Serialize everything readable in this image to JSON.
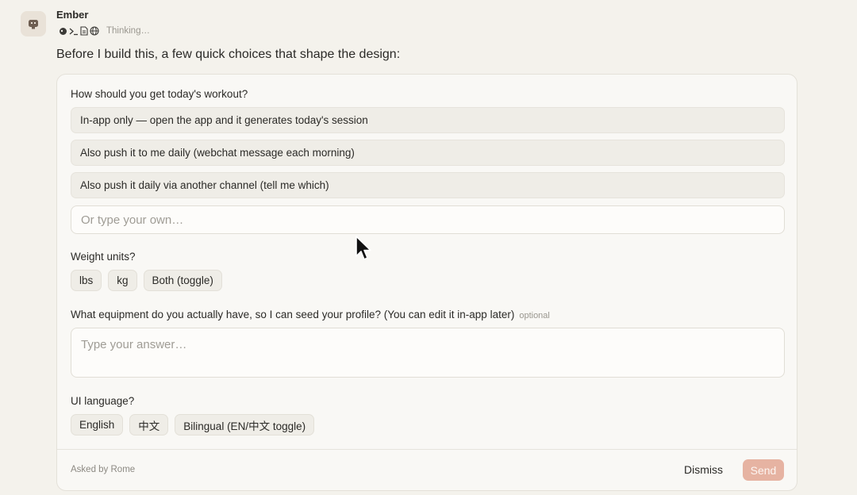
{
  "message": {
    "sender": "Ember",
    "status": "Thinking…",
    "status_icons": [
      "skill-icon",
      "terminal-icon",
      "document-icon",
      "globe-icon"
    ],
    "intro": "Before I build this, a few quick choices that shape the design:"
  },
  "form": {
    "q1": {
      "label": "How should you get today's workout?",
      "options": [
        "In-app only — open the app and it generates today's session",
        "Also push it to me daily (webchat message each morning)",
        "Also push it daily via another channel (tell me which)"
      ],
      "custom_placeholder": "Or type your own…"
    },
    "q2": {
      "label": "Weight units?",
      "options": [
        "lbs",
        "kg",
        "Both (toggle)"
      ]
    },
    "q3": {
      "label": "What equipment do you actually have, so I can seed your profile? (You can edit it in-app later)",
      "optional_tag": "optional",
      "placeholder": "Type your answer…"
    },
    "q4": {
      "label": "UI language?",
      "options": [
        "English",
        "中文",
        "Bilingual (EN/中文 toggle)"
      ]
    }
  },
  "footer": {
    "asked_by": "Asked by Rome",
    "dismiss_label": "Dismiss",
    "send_label": "Send"
  },
  "colors": {
    "background": "#f4f2ec",
    "card": "#f9f8f5",
    "option_bg": "#efede7",
    "send_button": "#e6b3a2"
  }
}
